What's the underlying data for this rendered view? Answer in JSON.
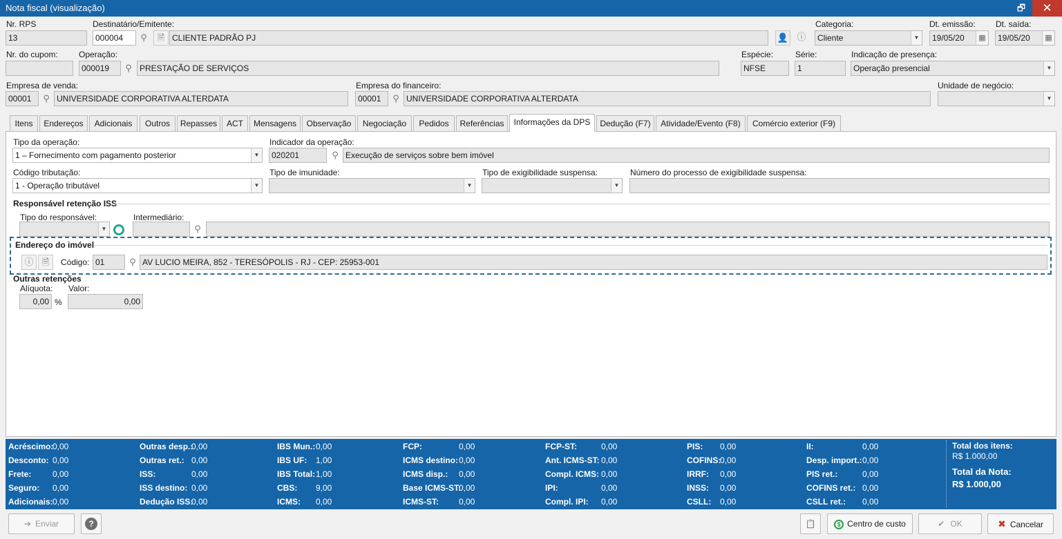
{
  "window": {
    "title": "Nota fiscal (visualização)",
    "restore_glyph": "🗗",
    "close_glyph": "✕"
  },
  "header": {
    "nr_rps": {
      "label": "Nr. RPS",
      "value": "13"
    },
    "destinatario": {
      "label": "Destinatário/Emitente:",
      "code": "000004",
      "name": "CLIENTE PADRÃO PJ"
    },
    "categoria": {
      "label": "Categoria:",
      "value": "Cliente"
    },
    "dt_emissao": {
      "label": "Dt. emissão:",
      "value": "19/05/20"
    },
    "dt_saida": {
      "label": "Dt. saída:",
      "value": "19/05/20"
    },
    "nr_cupom": {
      "label": "Nr. do cupom:",
      "value": ""
    },
    "operacao": {
      "label": "Operação:",
      "code": "000019",
      "name": "PRESTAÇÃO DE SERVIÇOS"
    },
    "especie": {
      "label": "Espécie:",
      "value": "NFSE"
    },
    "serie": {
      "label": "Série:",
      "value": "1"
    },
    "presenca": {
      "label": "Indicação de presença:",
      "value": "Operação presencial"
    },
    "empresa_venda": {
      "label": "Empresa de venda:",
      "code": "00001",
      "name": "UNIVERSIDADE CORPORATIVA ALTERDATA"
    },
    "empresa_financeiro": {
      "label": "Empresa do financeiro:",
      "code": "00001",
      "name": "UNIVERSIDADE CORPORATIVA ALTERDATA"
    },
    "unidade_negocio": {
      "label": "Unidade de negócio:",
      "value": ""
    }
  },
  "tabs": [
    {
      "label": "Itens"
    },
    {
      "label": "Endereços"
    },
    {
      "label": "Adicionais"
    },
    {
      "label": "Outros"
    },
    {
      "label": "Repasses"
    },
    {
      "label": "ACT"
    },
    {
      "label": "Mensagens"
    },
    {
      "label": "Observação"
    },
    {
      "label": "Negociação"
    },
    {
      "label": "Pedidos"
    },
    {
      "label": "Referências"
    },
    {
      "label": "Informações da DPS"
    },
    {
      "label": "Dedução (F7)"
    },
    {
      "label": "Atividade/Evento (F8)"
    },
    {
      "label": "Comércio exterior (F9)"
    }
  ],
  "dps": {
    "tipo_operacao": {
      "label": "Tipo da operação:",
      "value": "1 – Fornecimento com pagamento posterior"
    },
    "indicador_operacao": {
      "label": "Indicador da operação:",
      "code": "020201",
      "name": "Execução de serviços sobre bem imóvel"
    },
    "codigo_tributacao": {
      "label": "Código tributação:",
      "value": "1 - Operação tributável"
    },
    "tipo_imunidade": {
      "label": "Tipo de imunidade:",
      "value": ""
    },
    "tipo_exigibilidade": {
      "label": "Tipo de exigibilidade suspensa:",
      "value": ""
    },
    "numero_processo": {
      "label": "Número do processo de exigibilidade suspensa:",
      "value": ""
    },
    "retencao_iss": {
      "title": "Responsável retenção ISS",
      "tipo_responsavel_label": "Tipo do responsável:",
      "intermediario_label": "Intermediário:"
    },
    "endereco_imovel": {
      "title": "Endereço do imóvel",
      "codigo_label": "Código:",
      "code": "01",
      "address": "AV LUCIO MEIRA, 852 - TERESÓPOLIS - RJ - CEP: 25953-001"
    },
    "outras_retencoes": {
      "title": "Outras retenções",
      "aliquota_label": "Alíquota:",
      "aliquota_value": "0,00",
      "percent_sign": "%",
      "valor_label": "Valor:",
      "valor_value": "0,00"
    }
  },
  "totals": {
    "col1": [
      {
        "label": "Acréscimo:",
        "value": "0,00"
      },
      {
        "label": "Desconto:",
        "value": "0,00"
      },
      {
        "label": "Frete:",
        "value": "0,00"
      },
      {
        "label": "Seguro:",
        "value": "0,00"
      },
      {
        "label": "Adicionais:",
        "value": "0,00"
      }
    ],
    "col2": [
      {
        "label": "Outras desp.:",
        "value": "0,00"
      },
      {
        "label": "Outras ret.:",
        "value": "0,00"
      },
      {
        "label": "ISS:",
        "value": "0,00"
      },
      {
        "label": "ISS destino:",
        "value": "0,00"
      },
      {
        "label": "Dedução ISS:",
        "value": "0,00"
      }
    ],
    "col3": [
      {
        "label": "IBS Mun.:",
        "value": "0,00"
      },
      {
        "label": "IBS UF:",
        "value": "1,00"
      },
      {
        "label": "IBS Total:",
        "value": "1,00"
      },
      {
        "label": "CBS:",
        "value": "9,00"
      },
      {
        "label": "ICMS:",
        "value": "0,00"
      }
    ],
    "col4": [
      {
        "label": "FCP:",
        "value": "0,00"
      },
      {
        "label": "ICMS destino:",
        "value": "0,00"
      },
      {
        "label": "ICMS disp.:",
        "value": "0,00"
      },
      {
        "label": "Base ICMS-ST:",
        "value": "0,00"
      },
      {
        "label": "ICMS-ST:",
        "value": "0,00"
      }
    ],
    "col5": [
      {
        "label": "FCP-ST:",
        "value": "0,00"
      },
      {
        "label": "Ant. ICMS-ST:",
        "value": "0,00"
      },
      {
        "label": "Compl. ICMS:",
        "value": "0,00"
      },
      {
        "label": "IPI:",
        "value": "0,00"
      },
      {
        "label": "Compl. IPI:",
        "value": "0,00"
      }
    ],
    "col6": [
      {
        "label": "PIS:",
        "value": "0,00"
      },
      {
        "label": "COFINS:",
        "value": "0,00"
      },
      {
        "label": "IRRF:",
        "value": "0,00"
      },
      {
        "label": "INSS:",
        "value": "0,00"
      },
      {
        "label": "CSLL:",
        "value": "0,00"
      }
    ],
    "col7": [
      {
        "label": "II:",
        "value": "0,00"
      },
      {
        "label": "Desp. import.:",
        "value": "0,00"
      },
      {
        "label": "PIS ret.:",
        "value": "0,00"
      },
      {
        "label": "COFINS ret.:",
        "value": "0,00"
      },
      {
        "label": "CSLL ret.:",
        "value": "0,00"
      }
    ],
    "total_itens_label": "Total dos itens:",
    "total_itens_value": "R$ 1.000,00",
    "total_nota_label": "Total da Nota:",
    "total_nota_value": "R$ 1.000,00"
  },
  "buttons": {
    "enviar": "Enviar",
    "help": "?",
    "centro_custo": "Centro de custo",
    "ok": "OK",
    "cancelar": "Cancelar"
  }
}
